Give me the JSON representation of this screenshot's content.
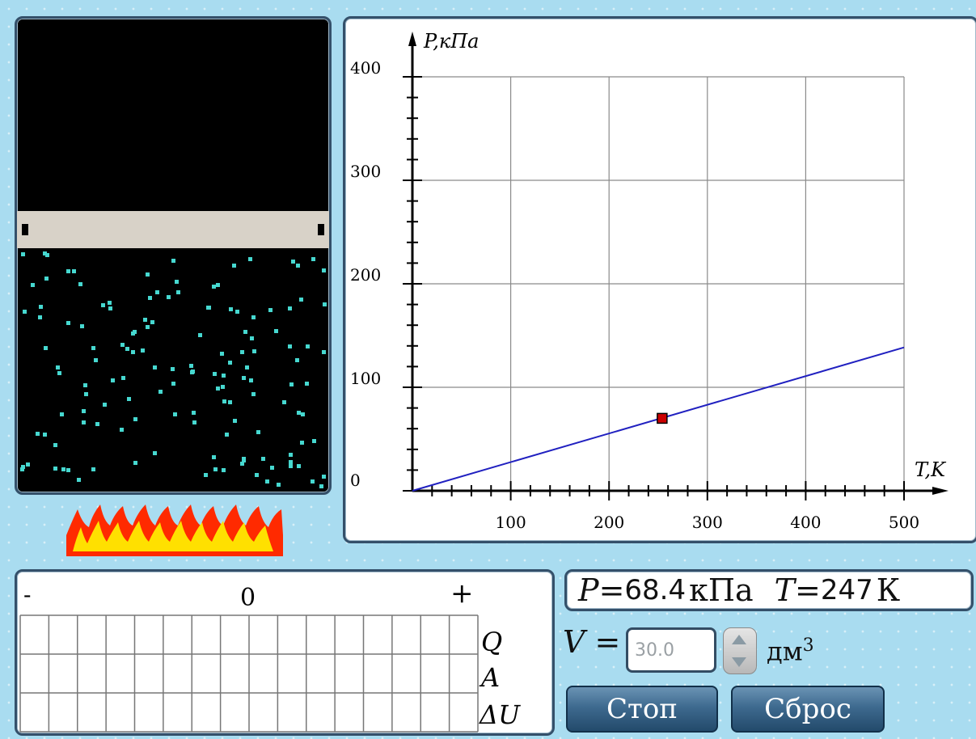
{
  "graph": {
    "y_axis_label": "P,кПа",
    "x_axis_label": "T,K",
    "y_ticks": [
      "0",
      "100",
      "200",
      "300",
      "400"
    ],
    "x_ticks": [
      "100",
      "200",
      "300",
      "400",
      "500"
    ]
  },
  "chart_data": {
    "type": "line",
    "x": [
      0,
      500
    ],
    "y": [
      0,
      138.5
    ],
    "current_point": {
      "x": 254,
      "y": 70
    },
    "xlabel": "T,K",
    "ylabel": "P,кПа",
    "xlim": [
      0,
      500
    ],
    "ylim": [
      0,
      400
    ],
    "grid": true,
    "line_color": "#2020c0",
    "point_color": "#cc0000"
  },
  "energy": {
    "minus": "-",
    "zero": "0",
    "plus": "+",
    "rows": [
      "Q",
      "A",
      "ΔU"
    ]
  },
  "readout": {
    "p_symbol": "P",
    "p_eq": "=",
    "p_value": "68.4",
    "p_unit": "кПа",
    "t_symbol": "T",
    "t_eq": "=",
    "t_value": "247",
    "t_unit": "К"
  },
  "volume": {
    "symbol": "V",
    "eq": "=",
    "value": "30.0",
    "unit": "дм",
    "unit_exp": "3"
  },
  "buttons": {
    "stop": "Стоп",
    "reset": "Сброс"
  },
  "colors": {
    "molecule": "#46d8d0",
    "flame_outer": "#ff2a00",
    "flame_inner": "#ffe000"
  }
}
